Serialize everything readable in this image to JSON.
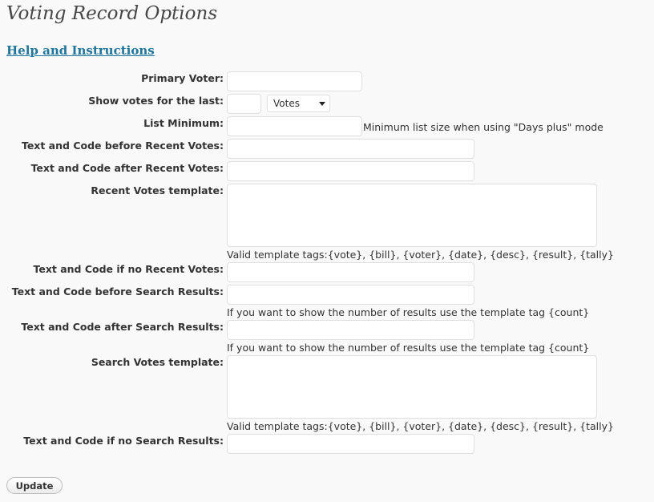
{
  "page": {
    "title": "Voting Record Options",
    "help_link": "Help and Instructions"
  },
  "form": {
    "primary_voter_label": "Primary Voter:",
    "primary_voter_value": "",
    "show_votes_label": "Show votes for the last:",
    "show_votes_value": "",
    "show_votes_unit_selected": "Votes",
    "list_minimum_label": "List Minimum:",
    "list_minimum_value": "",
    "list_minimum_hint": "Minimum list size when using \"Days plus\" mode",
    "before_recent_label": "Text and Code before Recent Votes:",
    "after_recent_label": "Text and Code after Recent Votes:",
    "recent_template_label": "Recent Votes template:",
    "recent_template_hint": "Valid template tags:{vote}, {bill}, {voter}, {date}, {desc}, {result}, {tally}",
    "no_recent_label": "Text and Code if no Recent Votes:",
    "before_search_label": "Text and Code before Search Results:",
    "before_search_hint": "If you want to show the number of results use the template tag {count}",
    "after_search_label": "Text and Code after Search Results:",
    "after_search_hint": "If you want to show the number of results use the template tag {count}",
    "search_template_label": "Search Votes template:",
    "search_template_hint": "Valid template tags:{vote}, {bill}, {voter}, {date}, {desc}, {result}, {tally}",
    "no_search_label": "Text and Code if no Search Results:",
    "update_button": "Update"
  }
}
